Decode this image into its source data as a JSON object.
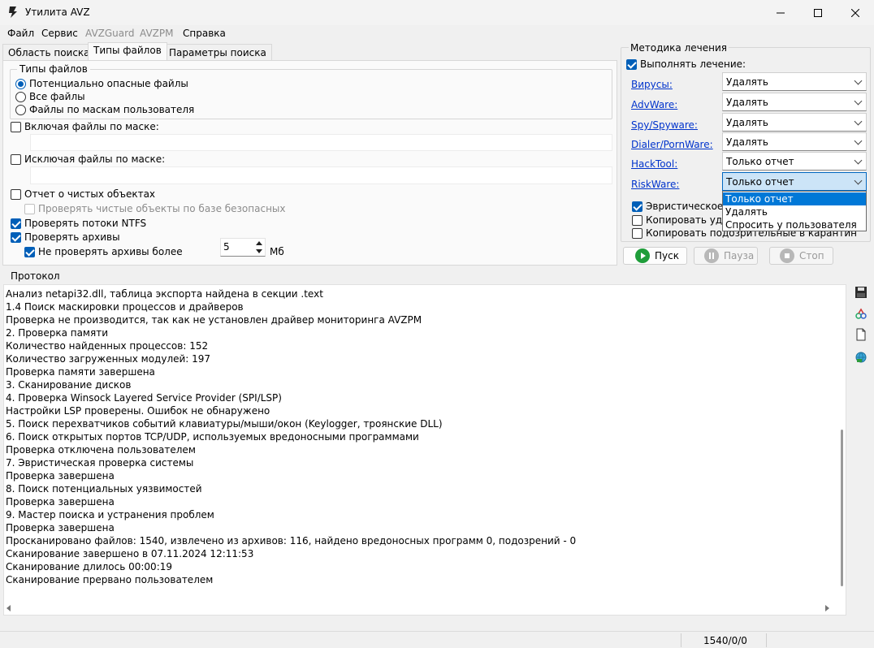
{
  "window": {
    "title": "Утилита AVZ"
  },
  "menu": [
    "Файл",
    "Сервис",
    "AVZGuard",
    "AVZPM",
    "Справка"
  ],
  "tabs": [
    "Область поиска",
    "Типы файлов",
    "Параметры поиска"
  ],
  "file_types": {
    "group_title": "Типы файлов",
    "options": [
      "Потенциально опасные файлы",
      "Все файлы",
      "Файлы по маскам пользователя"
    ],
    "selected": "Потенциально опасные файлы"
  },
  "include_mask": {
    "label": "Включая файлы по маске:",
    "checked": false,
    "value": ""
  },
  "exclude_mask": {
    "label": "Исключая файлы по маске:",
    "checked": false,
    "value": ""
  },
  "clean_report": {
    "label": "Отчет о чистых объектах",
    "checked": false
  },
  "check_clean_safe": {
    "label": "Проверять чистые объекты по базе безопасных",
    "checked": false,
    "enabled": false
  },
  "check_ntfs": {
    "label": "Проверять потоки NTFS",
    "checked": true
  },
  "check_archives": {
    "label": "Проверять архивы",
    "checked": true
  },
  "skip_archives": {
    "label": "Не проверять архивы более",
    "checked": true,
    "value": "5",
    "unit": "Мб"
  },
  "treatment": {
    "title": "Методика лечения",
    "perform_label": "Выполнять лечение:",
    "perform_checked": true,
    "rows": [
      {
        "label": "Вирусы:",
        "value": "Удалять"
      },
      {
        "label": "AdvWare:",
        "value": "Удалять"
      },
      {
        "label": "Spy/Spyware:",
        "value": "Удалять"
      },
      {
        "label": "Dialer/PornWare:",
        "value": "Удалять"
      },
      {
        "label": "HackTool:",
        "value": "Только отчет"
      },
      {
        "label": "RiskWare:",
        "value": "Только отчет"
      }
    ],
    "dropdown_options": [
      "Только отчет",
      "Удалять",
      "Спросить у пользователя"
    ],
    "dropdown_selected": "Только отчет",
    "heuristic_label": "Эвристическое у",
    "heuristic_checked": true,
    "copy_deleted_label": "Копировать уда",
    "copy_deleted_checked": false,
    "copy_suspicious_label": "Копировать подозрительные в  карантин",
    "copy_suspicious_checked": false
  },
  "buttons": {
    "start": "Пуск",
    "pause": "Пауза",
    "stop": "Стоп"
  },
  "protocol": {
    "title": "Протокол",
    "lines": [
      " Анализ netapi32.dll, таблица экспорта найдена в секции .text",
      "1.4 Поиск маскировки процессов и драйверов",
      " Проверка не производится, так как не установлен драйвер мониторинга AVZPM",
      "2. Проверка памяти",
      " Количество найденных процессов: 152",
      " Количество загруженных модулей: 197",
      "Проверка памяти завершена",
      "3. Сканирование дисков",
      "4. Проверка Winsock Layered Service Provider (SPI/LSP)",
      " Настройки LSP проверены. Ошибок не обнаружено",
      "5. Поиск перехватчиков событий клавиатуры/мыши/окон (Keylogger, троянские DLL)",
      "6. Поиск открытых портов TCP/UDP, используемых вредоносными программами",
      " Проверка отключена пользователем",
      "7. Эвристическая проверка системы",
      "Проверка завершена",
      "8. Поиск потенциальных уязвимостей",
      "Проверка завершена",
      "9. Мастер поиска и устранения проблем",
      "Проверка завершена",
      "Просканировано файлов: 1540, извлечено из архивов: 116, найдено вредоносных программ 0, подозрений - 0",
      "Сканирование завершено в 07.11.2024 12:11:53",
      "Сканирование длилось 00:00:19",
      "Сканирование прервано пользователем"
    ]
  },
  "status": {
    "counter": "1540/0/0"
  },
  "colors": {
    "accent": "#005fb8",
    "link": "#0033cc",
    "start_green": "#1f9d3a",
    "selection": "#0078d7"
  },
  "icons": [
    "avz-app-icon",
    "minimize-icon",
    "maximize-icon",
    "close-icon",
    "play-icon",
    "pause-icon",
    "stop-icon",
    "save-icon",
    "tool-icon",
    "document-icon",
    "network-icon"
  ]
}
